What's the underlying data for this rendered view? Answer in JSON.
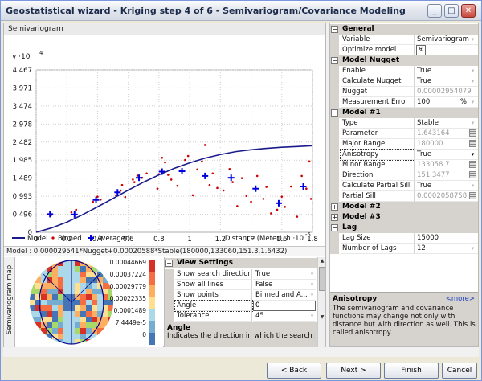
{
  "window": {
    "title": "Geostatistical wizard - Kriging step 4 of 6 - Semivariogram/Covariance Modeling",
    "min_icon": "minimize-icon",
    "max_icon": "maximize-icon",
    "close_icon": "close-icon"
  },
  "chart_header": "Semivariogram",
  "chart_data": {
    "type": "scatter",
    "title": "",
    "ylabel": "γ ·10",
    "ylabel_exponent": "4",
    "xlabel": "Distance (Meter), h ·10",
    "xlabel_exponent": "-5",
    "xlim": [
      0,
      1.8
    ],
    "ylim": [
      0,
      4.467
    ],
    "x_ticks": [
      "0",
      "0.2",
      "0.4",
      "0.6",
      "0.8",
      "1",
      "1.2",
      "1.4",
      "1.6",
      "1.8"
    ],
    "y_ticks": [
      "0.496",
      "0.993",
      "1.489",
      "1.985",
      "2.482",
      "2.978",
      "3.474",
      "3.971",
      "4.467"
    ],
    "legend": [
      {
        "label": "Model",
        "marker": "line",
        "color": "#1a1a8c"
      },
      {
        "label": "Binned",
        "marker": "dot",
        "color": "#cc0000"
      },
      {
        "label": "Averaged",
        "marker": "plus",
        "color": "#0000dd"
      }
    ],
    "model_curve": {
      "name": "Model",
      "sill": 2.4,
      "range": 1.8,
      "x": [
        0,
        0.1,
        0.2,
        0.3,
        0.4,
        0.5,
        0.6,
        0.7,
        0.8,
        0.9,
        1.0,
        1.1,
        1.2,
        1.3,
        1.4,
        1.5,
        1.6,
        1.7,
        1.8
      ],
      "y": [
        0,
        0.12,
        0.28,
        0.48,
        0.7,
        0.93,
        1.16,
        1.38,
        1.58,
        1.76,
        1.91,
        2.04,
        2.14,
        2.22,
        2.27,
        2.31,
        2.34,
        2.36,
        2.38
      ]
    },
    "averaged": {
      "name": "Averaged",
      "x": [
        0.09,
        0.25,
        0.39,
        0.53,
        0.67,
        0.82,
        0.95,
        1.1,
        1.27,
        1.43,
        1.58,
        1.74
      ],
      "y": [
        0.5,
        0.49,
        0.89,
        1.1,
        1.5,
        1.67,
        1.68,
        1.55,
        1.5,
        1.2,
        0.8,
        1.26
      ]
    },
    "binned": {
      "name": "Binned",
      "x": [
        0.1,
        0.23,
        0.26,
        0.37,
        0.4,
        0.42,
        0.52,
        0.55,
        0.56,
        0.58,
        0.63,
        0.64,
        0.66,
        0.69,
        0.72,
        0.79,
        0.8,
        0.82,
        0.84,
        0.86,
        0.88,
        0.92,
        0.94,
        0.97,
        0.99,
        1.02,
        1.05,
        1.08,
        1.1,
        1.13,
        1.15,
        1.18,
        1.22,
        1.26,
        1.28,
        1.31,
        1.34,
        1.37,
        1.4,
        1.44,
        1.48,
        1.5,
        1.53,
        1.57,
        1.6,
        1.62,
        1.66,
        1.7,
        1.73,
        1.76,
        1.78,
        1.79
      ],
      "y": [
        0.48,
        0.55,
        0.62,
        0.84,
        0.98,
        0.9,
        1.02,
        1.15,
        1.3,
        0.97,
        1.45,
        1.38,
        1.56,
        1.5,
        1.62,
        1.2,
        1.6,
        2.05,
        1.92,
        1.58,
        1.45,
        1.28,
        1.7,
        1.99,
        2.1,
        1.02,
        1.73,
        1.95,
        2.4,
        1.3,
        1.62,
        1.22,
        1.15,
        1.74,
        1.38,
        0.72,
        1.49,
        1.0,
        0.84,
        1.55,
        0.92,
        1.25,
        0.52,
        0.62,
        0.98,
        0.7,
        1.26,
        0.43,
        1.55,
        1.2,
        1.95,
        0.92
      ]
    }
  },
  "model_equation": "Model : 0.000029541*Nugget+0.00020588*Stable(180000,133060,151.3,1.6432)",
  "map": {
    "side_label": "Semivariogram map",
    "scale": [
      "0.00044669",
      "0.00037224",
      "0.00029779",
      "0.00022335",
      "0.0001489",
      "7.4449e-5",
      "0"
    ],
    "colors": {
      "high": "#d73027",
      "mid": "#fdae61",
      "low": "#4575b4",
      "teal": "#abd9e9",
      "yellow": "#fee090"
    }
  },
  "view_settings": {
    "title": "View Settings",
    "rows": [
      {
        "name": "Show search direction",
        "value": "True"
      },
      {
        "name": "Show all lines",
        "value": "False"
      },
      {
        "name": "Show points",
        "value": "Binned and A..."
      },
      {
        "name": "Angle",
        "value": "0"
      },
      {
        "name": "Tolerance",
        "value": "45"
      }
    ],
    "desc_title": "Angle",
    "desc_text": "Indicates the direction in which the search sector ..."
  },
  "properties": {
    "general": {
      "title": "General",
      "rows": [
        {
          "name": "Variable",
          "value": "Semivariogram"
        },
        {
          "name": "Optimize model",
          "value": ""
        }
      ]
    },
    "nugget": {
      "title": "Model Nugget",
      "rows": [
        {
          "name": "Enable",
          "value": "True"
        },
        {
          "name": "Calculate Nugget",
          "value": "True"
        },
        {
          "name": "Nugget",
          "value": "0.00002954079"
        },
        {
          "name": "Measurement Error",
          "value": "100",
          "unit": "%"
        }
      ]
    },
    "model1": {
      "title": "Model #1",
      "rows": [
        {
          "name": "Type",
          "value": "Stable"
        },
        {
          "name": "Parameter",
          "value": "1.643164"
        },
        {
          "name": "Major Range",
          "value": "180000"
        },
        {
          "name": "Anisotropy",
          "value": "True"
        },
        {
          "name": "Minor Range",
          "value": "133058.7"
        },
        {
          "name": "Direction",
          "value": "151.3477"
        },
        {
          "name": "Calculate Partial Sill",
          "value": "True"
        },
        {
          "name": "Partial Sill",
          "value": "0.0002058758"
        }
      ]
    },
    "model2": {
      "title": "Model #2"
    },
    "model3": {
      "title": "Model #3"
    },
    "lag": {
      "title": "Lag",
      "rows": [
        {
          "name": "Lag Size",
          "value": "15000"
        },
        {
          "name": "Number of Lags",
          "value": "12"
        }
      ]
    },
    "desc_title": "Anisotropy",
    "desc_more": "<more>",
    "desc_text": "The semivariogram and covariance functions may change not only with distance but with direction as well. This is called anisotropy."
  },
  "buttons": {
    "back": "< Back",
    "next": "Next >",
    "finish": "Finish",
    "cancel": "Cancel"
  }
}
